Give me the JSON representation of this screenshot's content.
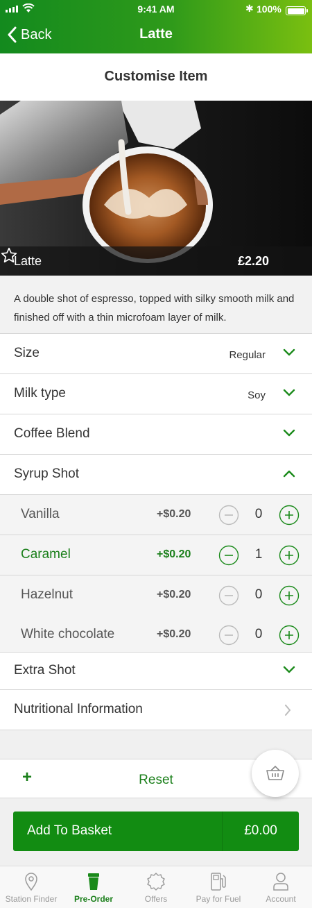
{
  "status_bar": {
    "time": "9:41 AM",
    "battery": "100%"
  },
  "nav": {
    "back_label": "Back",
    "title": "Latte"
  },
  "subheader": "Customise Item",
  "product": {
    "name": "Latte",
    "price": "£2.20",
    "description": "A double shot of espresso, topped with silky smooth milk and finished off with a thin microfoam layer of milk."
  },
  "options": {
    "size": {
      "label": "Size",
      "value": "Regular"
    },
    "milk": {
      "label": "Milk type",
      "value": "Soy"
    },
    "blend": {
      "label": "Coffee Blend"
    },
    "syrup": {
      "label": "Syrup Shot"
    },
    "extra": {
      "label": "Extra Shot"
    },
    "nutrition": {
      "label": "Nutritional Information"
    }
  },
  "syrups": [
    {
      "name": "Vanilla",
      "price": "+$0.20",
      "qty": "0"
    },
    {
      "name": "Caramel",
      "price": "+$0.20",
      "qty": "1"
    },
    {
      "name": "Hazelnut",
      "price": "+$0.20",
      "qty": "0"
    },
    {
      "name": "White chocolate",
      "price": "+$0.20",
      "qty": "0"
    }
  ],
  "reset": {
    "plus": "+",
    "label": "Reset"
  },
  "add_to_basket": {
    "label": "Add To Basket",
    "total": "£0.00"
  },
  "tabs": [
    {
      "label": "Station Finder",
      "icon": "map-pin-icon"
    },
    {
      "label": "Pre-Order",
      "icon": "coffee-cup-icon",
      "active": true
    },
    {
      "label": "Offers",
      "icon": "offer-badge-icon"
    },
    {
      "label": "Pay for Fuel",
      "icon": "fuel-pump-icon"
    },
    {
      "label": "Account",
      "icon": "person-icon"
    }
  ],
  "colors": {
    "brand_green": "#128c12",
    "header_gradient_start": "#138a1e",
    "header_gradient_end": "#7abf10",
    "accent_text": "#1a7f1a"
  }
}
